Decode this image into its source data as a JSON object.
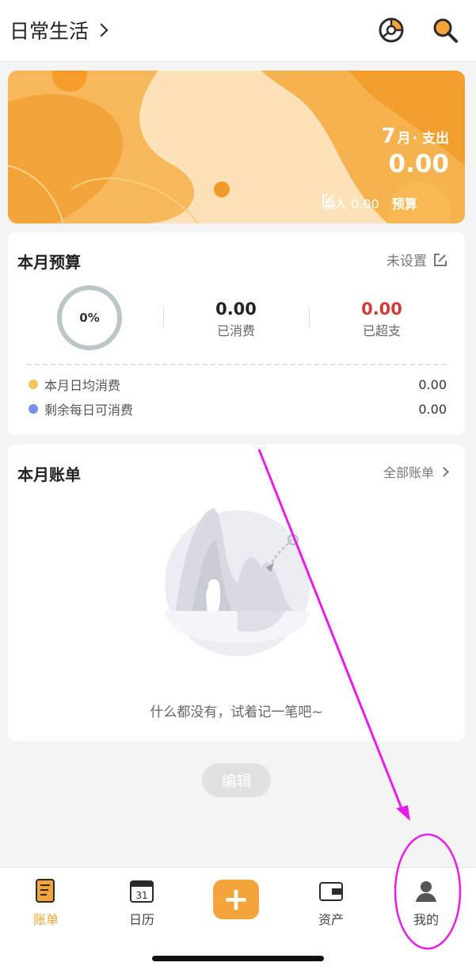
{
  "header": {
    "book_name": "日常生活"
  },
  "banner": {
    "month": "7",
    "month_unit": "月",
    "mode_label": "· 支出",
    "amount": "0.00",
    "income_label": "收入 0.00",
    "budget_label": "预算"
  },
  "budget": {
    "title": "本月预算",
    "status": "未设置",
    "percent": "0%",
    "spent_value": "0.00",
    "spent_label": "已消费",
    "over_value": "0.00",
    "over_label": "已超支",
    "rows": [
      {
        "label": "本月日均消费",
        "value": "0.00",
        "dot_color": "#f0c75a"
      },
      {
        "label": "剩余每日可消费",
        "value": "0.00",
        "dot_color": "#7b8fe8"
      }
    ]
  },
  "bills": {
    "title": "本月账单",
    "all_link": "全部账单",
    "empty_text": "什么都没有，试着记一笔吧~"
  },
  "edit_button": "编辑",
  "tabs": [
    {
      "label": "账单",
      "active": true
    },
    {
      "label": "日历",
      "calendar_day": "31"
    },
    {
      "label": ""
    },
    {
      "label": "资产"
    },
    {
      "label": "我的"
    }
  ],
  "add_button": "+",
  "colors": {
    "accent": "#f3a43a",
    "over_red": "#d13a3a",
    "annotation": "#e61ee6"
  }
}
